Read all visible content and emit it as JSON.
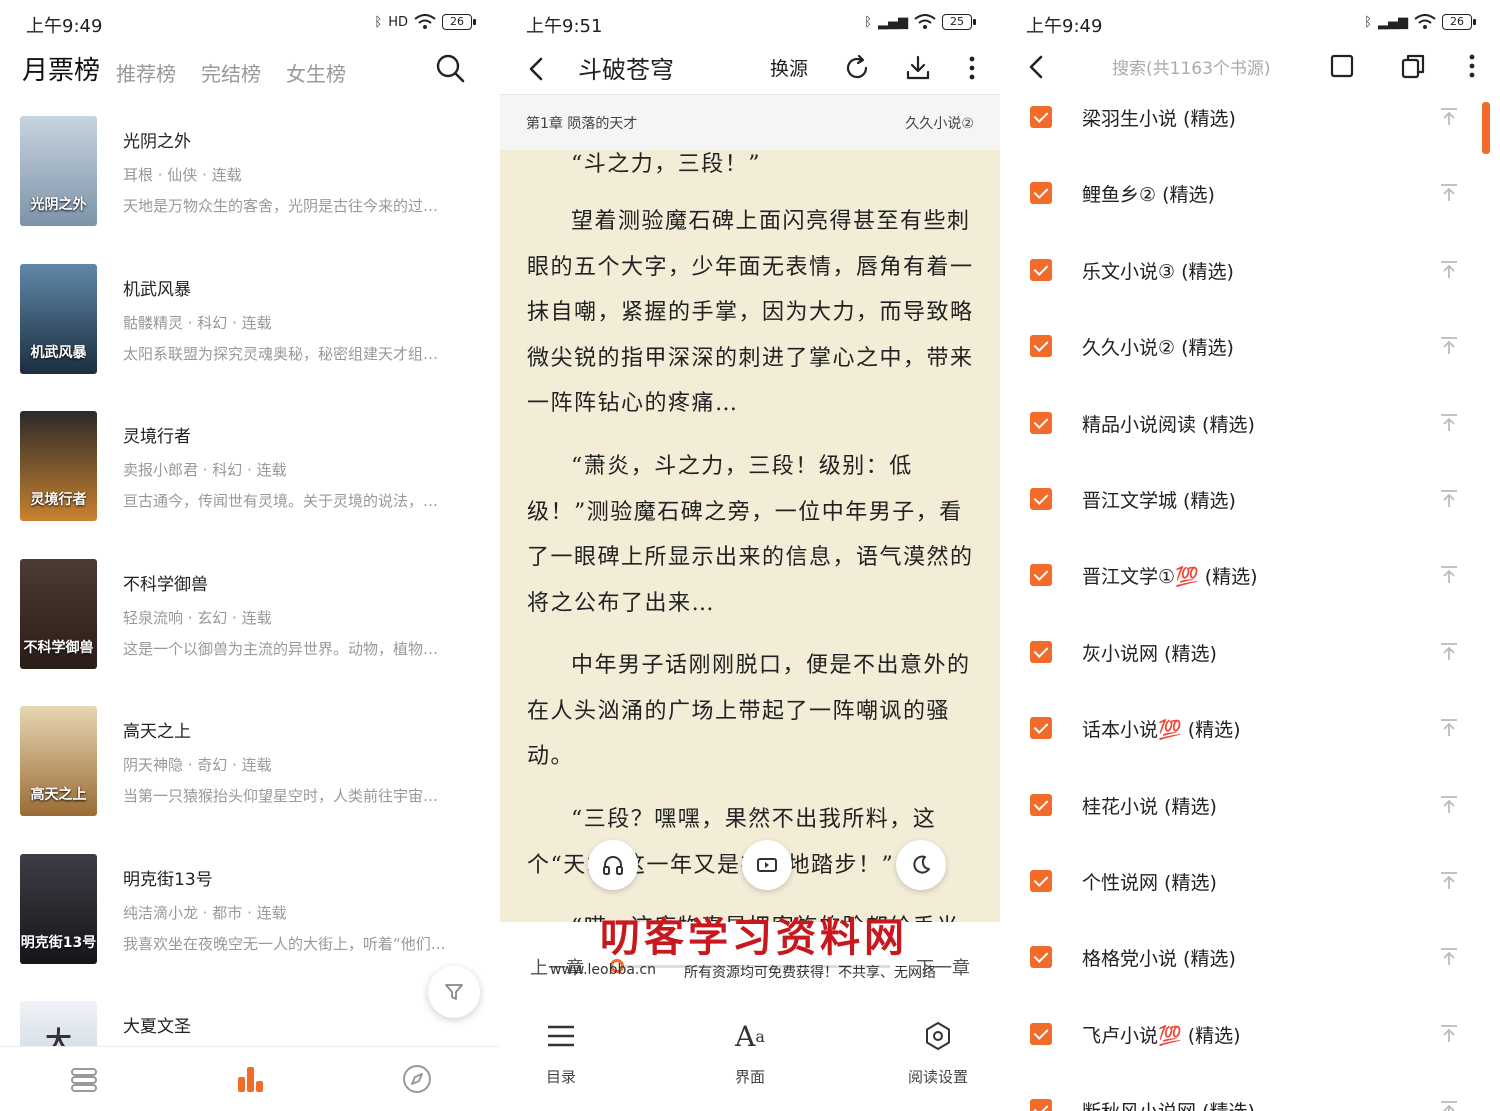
{
  "panel1": {
    "status": {
      "time": "上午9:49",
      "battery": "26",
      "signal": "HD"
    },
    "tabs": {
      "active": "月票榜",
      "items": [
        "推荐榜",
        "完结榜",
        "女生榜"
      ]
    },
    "books": [
      {
        "title": "光阴之外",
        "meta": "耳根 · 仙侠 · 连载",
        "desc": "天地是万物众生的客舍，光阴是古往今来的过…",
        "cover_text": "光阴之外",
        "cover_color": "#9fb4c8"
      },
      {
        "title": "机武风暴",
        "meta": "骷髅精灵 · 科幻 · 连载",
        "desc": "太阳系联盟为探究灵魂奥秘，秘密组建天才组…",
        "cover_text": "机武风暴",
        "cover_color": "#2d4a63"
      },
      {
        "title": "灵境行者",
        "meta": "卖报小郎君 · 科幻 · 连载",
        "desc": "亘古通今，传闻世有灵境。关于灵境的说法，…",
        "cover_text": "灵境行者",
        "cover_color": "#5a3b24"
      },
      {
        "title": "不科学御兽",
        "meta": "轻泉流响 · 玄幻 · 连载",
        "desc": "这是一个以御兽为主流的异世界。动物，植物…",
        "cover_text": "不科学御兽",
        "cover_color": "#3a2a22"
      },
      {
        "title": "高天之上",
        "meta": "阴天神隐 · 奇幻 · 连载",
        "desc": "当第一只猿猴抬头仰望星空时，人类前往宇宙…",
        "cover_text": "高天之上",
        "cover_color": "#c89a52"
      },
      {
        "title": "明克街13号",
        "meta": "纯洁滴小龙 · 都市 · 连载",
        "desc": "我喜欢坐在夜晚空无一人的大街上，听着“他们…",
        "cover_text": "明克街13号",
        "cover_color": "#2a2a30"
      },
      {
        "title": "大夏文圣",
        "meta": "",
        "desc": "",
        "cover_text": "大",
        "cover_color": "#dfe6ee"
      }
    ],
    "colors": {
      "accent": "#f26b2a"
    },
    "icons": [
      "search-icon",
      "filter-icon",
      "bookshelf-icon",
      "ranking-icon",
      "discover-icon"
    ]
  },
  "panel2": {
    "status": {
      "time": "上午9:51",
      "battery": "25"
    },
    "book_title": "斗破苍穹",
    "swap_source": "换源",
    "chapter_title": "第1章 陨落的天才",
    "chapter_source": "久久小说②",
    "paragraphs": [
      "“斗之力，三段！”",
      "望着测验魔石碑上面闪亮得甚至有些刺眼的五个大字，少年面无表情，唇角有着一抹自嘲，紧握的手掌，因为大力，而导致略微尖锐的指甲深深的刺进了掌心之中，带来一阵阵钻心的疼痛…",
      "“萧炎，斗之力，三段！级别：低级！”测验魔石碑之旁，一位中年男子，看了一眼碑上所显示出来的信息，语气漠然的将之公布了出来…",
      "中年男子话刚刚脱口，便是不出意外的在人头汹涌的广场上带起了一阵嘲讽的骚动。",
      "“三段？嘿嘿，果然不出我所料，这个“天才”这一年又是在原地踏步！”",
      "“哎，这废物真是把家族的脸都给丢光"
    ],
    "prev_chapter": "上一章",
    "next_chapter": "下一章",
    "progress": 0,
    "watermark_url": "www.leobba.cn",
    "watermark_note": "所有资源均可免费获得！不共享、无网络",
    "watermark_big": "叨客学习资料网",
    "menu": [
      {
        "label": "目录",
        "icon": "list-icon"
      },
      {
        "label": "界面",
        "icon": "font-icon"
      },
      {
        "label": "阅读设置",
        "icon": "settings-icon"
      }
    ],
    "background_color": "#f3ecd7"
  },
  "panel3": {
    "status": {
      "time": "上午9:49",
      "battery": "26"
    },
    "search_placeholder": "搜索(共1163个书源)",
    "sources": [
      "梁羽生小说 (精选)",
      "鲤鱼乡② (精选)",
      "乐文小说③ (精选)",
      "久久小说② (精选)",
      "精品小说阅读 (精选)",
      "晋江文学城 (精选)",
      "晋江文学①💯 (精选)",
      "灰小说网 (精选)",
      "话本小说💯 (精选)",
      "桂花小说 (精选)",
      "个性说网 (精选)",
      "格格党小说 (精选)",
      "飞卢小说💯 (精选)",
      "断秋风小说网 (精选)"
    ],
    "checked_color": "#f26b2a"
  }
}
